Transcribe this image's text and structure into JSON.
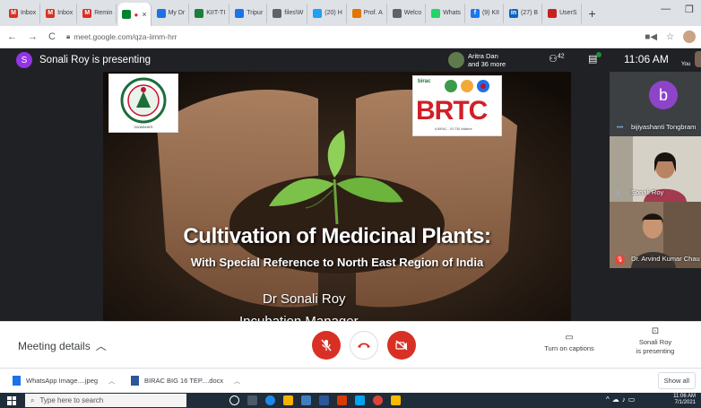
{
  "browser": {
    "tabs": [
      {
        "label": "Inbox",
        "icon": "gmail-icon",
        "color": "#d93025",
        "glyph": "M"
      },
      {
        "label": "Inbox",
        "icon": "gmail-icon",
        "color": "#d93025",
        "glyph": "M"
      },
      {
        "label": "Remin",
        "icon": "gmail-icon",
        "color": "#d93025",
        "glyph": "M"
      },
      {
        "label": "",
        "icon": "meet-icon",
        "color": "#00832d",
        "glyph": "",
        "active": true
      },
      {
        "label": "My Dr",
        "icon": "drive-icon",
        "color": "#1a73e8",
        "glyph": ""
      },
      {
        "label": "KIIT-TI",
        "icon": "classroom-icon",
        "color": "#188038",
        "glyph": ""
      },
      {
        "label": "Tripur",
        "icon": "globe-icon",
        "color": "#1a73e8",
        "glyph": ""
      },
      {
        "label": "files\\W",
        "icon": "globe-icon",
        "color": "#5f6368",
        "glyph": ""
      },
      {
        "label": "(20) H",
        "icon": "twitter-icon",
        "color": "#1da1f2",
        "glyph": ""
      },
      {
        "label": "Prof. A",
        "icon": "globe-icon",
        "color": "#e37400",
        "glyph": ""
      },
      {
        "label": "Welco",
        "icon": "globe-icon",
        "color": "#5f6368",
        "glyph": ""
      },
      {
        "label": "Whats",
        "icon": "whatsapp-icon",
        "color": "#25d366",
        "glyph": ""
      },
      {
        "label": "(9) KII",
        "icon": "facebook-icon",
        "color": "#1877f2",
        "glyph": "f"
      },
      {
        "label": "(27) B",
        "icon": "linkedin-icon",
        "color": "#0a66c2",
        "glyph": "in"
      },
      {
        "label": "UserS",
        "icon": "globe-icon",
        "color": "#c5221f",
        "glyph": ""
      }
    ],
    "new_tab": "+",
    "url": "meet.google.com/qza-iimm-hrr"
  },
  "meet": {
    "presenter_initial": "S",
    "presenter_banner": "Sonali Roy is presenting",
    "attendees_line1": "Aritra Dan",
    "attendees_line2": "and 36 more",
    "people_count": "42",
    "time": "11:06 AM",
    "you_label": "You"
  },
  "slide": {
    "logo_left_caption": "GUWAHATI",
    "logo_right_top": "birac",
    "logo_right_main": "BRTC",
    "logo_right_sub": "A BIRAC - IGI TBI Initiative",
    "title": "Cultivation of Medicinal Plants:",
    "subtitle": "With Special Reference to North East Region of India",
    "author": "Dr Sonali Roy",
    "role": "Incubation Manager"
  },
  "participants": [
    {
      "name": "bijiyashanti Tongbram",
      "initial": "b",
      "indicator": "•••"
    },
    {
      "name": "Sonali Roy",
      "indicator": "ıl"
    },
    {
      "name": "Dr. Arvind Kumar Chau",
      "muted": true
    }
  ],
  "controls": {
    "meeting_details": "Meeting details",
    "captions_label": "Turn on captions",
    "presenting_line1": "Sonali Roy",
    "presenting_line2": "is presenting"
  },
  "downloads": [
    {
      "name": "WhatsApp Image....jpeg",
      "color": "#1a73e8"
    },
    {
      "name": "BIRAC BIG 16 TEP....docx",
      "color": "#2b579a"
    }
  ],
  "show_all": "Show all",
  "taskbar": {
    "search_placeholder": "Type here to search",
    "time": "11:06 AM",
    "date": "7/1/2021"
  },
  "colors": {
    "red": "#d93025",
    "presenter_avatar": "#9334e6"
  }
}
